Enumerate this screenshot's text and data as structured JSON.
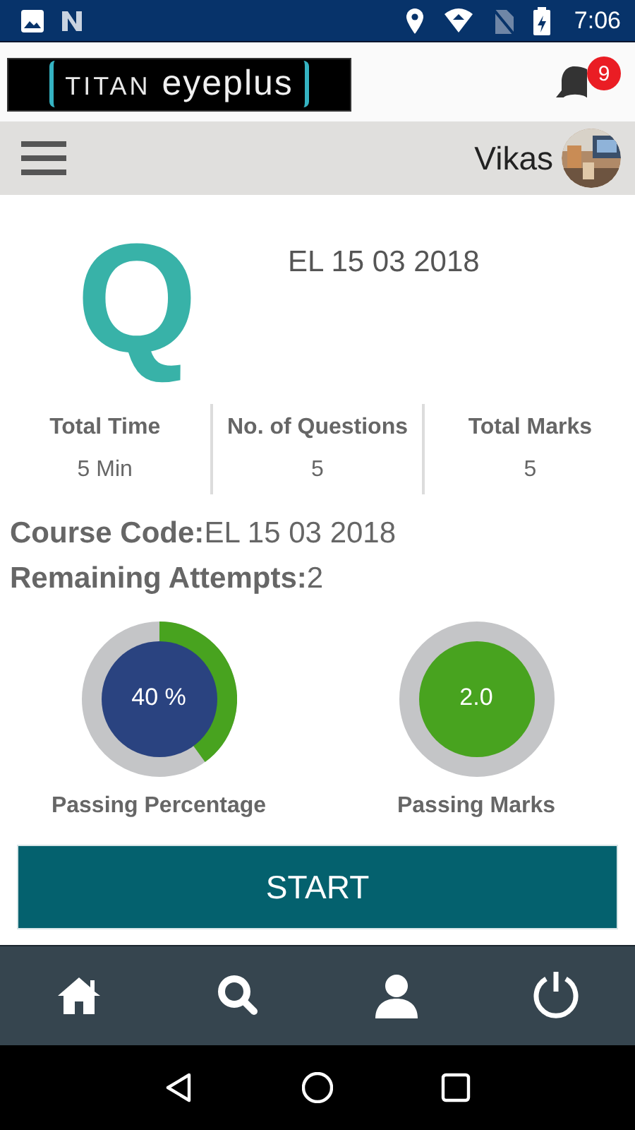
{
  "status_bar": {
    "time": "7:06"
  },
  "header": {
    "logo": {
      "word_1": "TITAN",
      "word_2": "eyeplus"
    },
    "notifications": {
      "count": "9"
    }
  },
  "toolbar": {
    "user_name": "Vikas"
  },
  "quiz": {
    "letter": "Q",
    "title": "EL 15 03 2018"
  },
  "stats": [
    {
      "label": "Total Time",
      "value": "5 Min"
    },
    {
      "label": "No. of Questions",
      "value": "5"
    },
    {
      "label": "Total Marks",
      "value": "5"
    }
  ],
  "details": [
    {
      "label": "Course Code:",
      "value": "EL 15 03 2018"
    },
    {
      "label": "Remaining Attempts:",
      "value": "2"
    }
  ],
  "gauges": [
    {
      "reading": "40 %",
      "label": "Passing Percentage",
      "kind": "arc",
      "color": "#2a4380"
    },
    {
      "reading": "2.0",
      "label": "Passing Marks",
      "kind": "plain",
      "color": "#48a31f"
    }
  ],
  "start_button": {
    "label": "START"
  },
  "bottom_nav": [
    {
      "kind": "home"
    },
    {
      "kind": "search"
    },
    {
      "kind": "profile"
    },
    {
      "kind": "power"
    }
  ],
  "system_nav": [
    {
      "kind": "back"
    },
    {
      "kind": "home"
    },
    {
      "kind": "recents"
    }
  ]
}
